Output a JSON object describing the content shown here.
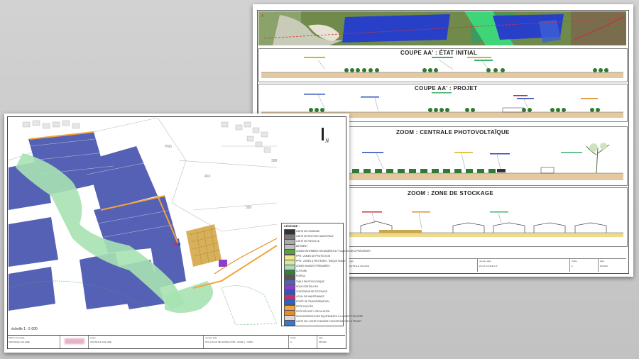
{
  "back_sheet": {
    "panels": {
      "initial": "COUPE AA' : ÉTAT INITIAL",
      "projet": "COUPE AA' : PROJET",
      "zoom_pv": "ZOOM : CENTRALE PHOTOVOLTAÏQUE",
      "zoom_stockage": "ZOOM : ZONE DE STOCKAGE"
    },
    "corner_labels": {
      "a": "A",
      "a_prime": "A'"
    },
    "title_block": {
      "projet_label": "projet",
      "projet_value": "CENTRALE SOLAIRE",
      "document_label": "numéro plan",
      "document_value": "PC3.2 COUPE A-A'",
      "indice_label": "indice",
      "indice_value": "A",
      "date_label": "date",
      "date_value": "06/2020"
    }
  },
  "front_sheet": {
    "north": "N",
    "parcels": [
      "HN5",
      "469",
      "389",
      "388"
    ],
    "scale": "échelle 1 : 5 000",
    "legend": {
      "title": "LÉGENDE :",
      "items": [
        {
          "label": "LIMITE DE COMMUNE",
          "color": "#333333"
        },
        {
          "label": "LIMITE DE SECTION CADASTRALE",
          "color": "#777777"
        },
        {
          "label": "LIMITE DE PARCELLE",
          "color": "#aaaaaa"
        },
        {
          "label": "BÂTIMENT",
          "color": "#bfbfbf"
        },
        {
          "label": "ZONES ENHERBÉES PAYSAGÈRES ET PLANTATIONS À PRÉSERVER",
          "color": "#5aa03c"
        },
        {
          "label": "PPRI : ZONES DE PROTECTION",
          "color": "#f2ea8a"
        },
        {
          "label": "PPRI : ZONES À PROTÉGER - RISQUE FAIBLE",
          "color": "#d9e8a0"
        },
        {
          "label": "ZONES HUMIDES PRÉSUMÉES",
          "color": "#a7dbc3"
        },
        {
          "label": "CLÔTURE",
          "color": "#3a7d3a"
        },
        {
          "label": "PORTAIL",
          "color": "#555555"
        },
        {
          "label": "TABLE PHOTOVOLTAÏQUE",
          "color": "#5561b4"
        },
        {
          "label": "SOUS-STATION HTB",
          "color": "#8a3ec9"
        },
        {
          "label": "CONTENEUR DE STOCKAGE",
          "color": "#3a4fc0"
        },
        {
          "label": "LOCAL DE MAINTENANCE",
          "color": "#c0306f"
        },
        {
          "label": "POSTE DE TRANSFORMATION",
          "color": "#2f62c8"
        },
        {
          "label": "PISTE D'ACCÈS",
          "color": "#f2a33a"
        },
        {
          "label": "PISTE DÉCAPÉ / CIRCULATION",
          "color": "#e88b2a"
        },
        {
          "label": "SOUS-EMPRISES DES ÉQUIPEMENTS À LA LIMITE FONCIÈRE",
          "color": "#d9d9d9"
        },
        {
          "label": "LIMITE DE L'UNITÉ FONCIÈRE CONCERNÉE PAR LE PROJET",
          "color": "#3a76c9"
        }
      ]
    },
    "title_block": {
      "maitre_label": "Maître d'ouvrage",
      "maitre_value": "CENTRALE SOLAIRE",
      "projet_label": "projet",
      "projet_value": "CENTRALE SOLAIRE",
      "document_label": "numéro plan",
      "document_value": "PC2.a PLAN DE MASSE CÔTÉ - ZONE 1 - NORD",
      "indice_label": "indice",
      "indice_value": "A",
      "date_label": "date",
      "date_value": "06/2020"
    }
  }
}
